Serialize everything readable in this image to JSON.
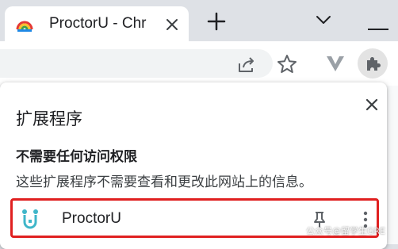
{
  "tab": {
    "title": "ProctorU - Chr",
    "favicon": "proctoru-rainbow-favicon-icon"
  },
  "toolbar": {
    "icons": [
      "share-icon",
      "star-icon",
      "v-extension-icon",
      "puzzle-icon"
    ]
  },
  "popup": {
    "title": "扩展程序",
    "section_heading": "不需要任何访问权限",
    "section_desc": "这些扩展程序不需要查看和更改此网站上的信息。",
    "extensions": [
      {
        "name": "ProctorU",
        "icon": "proctoru-extension-icon",
        "pinned": false
      }
    ]
  },
  "watermark": "公众号@留学生GRE",
  "colors": {
    "tabstrip": "#dee1e6",
    "highlight_border": "#e02020",
    "proctoru_teal": "#3fb6c9",
    "icon_gray": "#5f6368"
  }
}
